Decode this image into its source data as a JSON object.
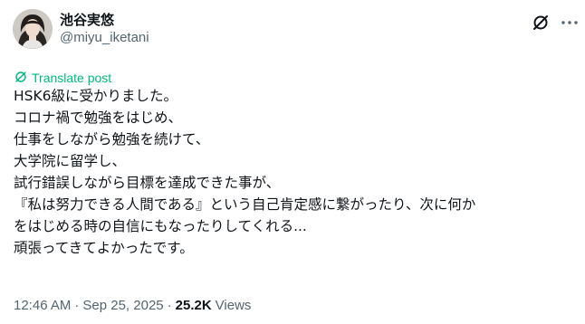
{
  "author": {
    "display_name": "池谷実悠",
    "handle": "@miyu_iketani"
  },
  "actions": {
    "grok_icon": "grok-icon",
    "more_icon": "more-icon"
  },
  "translate": {
    "label": "Translate post",
    "color": "#00ba7c"
  },
  "post": {
    "lines": [
      "HSK6級に受かりました。",
      "コロナ禍で勉強をはじめ、",
      "仕事をしながら勉強を続けて、",
      "大学院に留学し、",
      "試行錯誤しながら目標を達成できた事が、",
      "『私は努力できる人間である』という自己肯定感に繋がったり、次に何か",
      "をはじめる時の自信にもなったりしてくれる...",
      "頑張ってきてよかったです。"
    ]
  },
  "meta": {
    "time": "12:46 AM",
    "separator": "·",
    "date": "Sep 25, 2025",
    "views_count": "25.2K",
    "views_label": "Views"
  },
  "colors": {
    "text": "#0f1419",
    "secondary": "#536471",
    "accent": "#00ba7c"
  }
}
